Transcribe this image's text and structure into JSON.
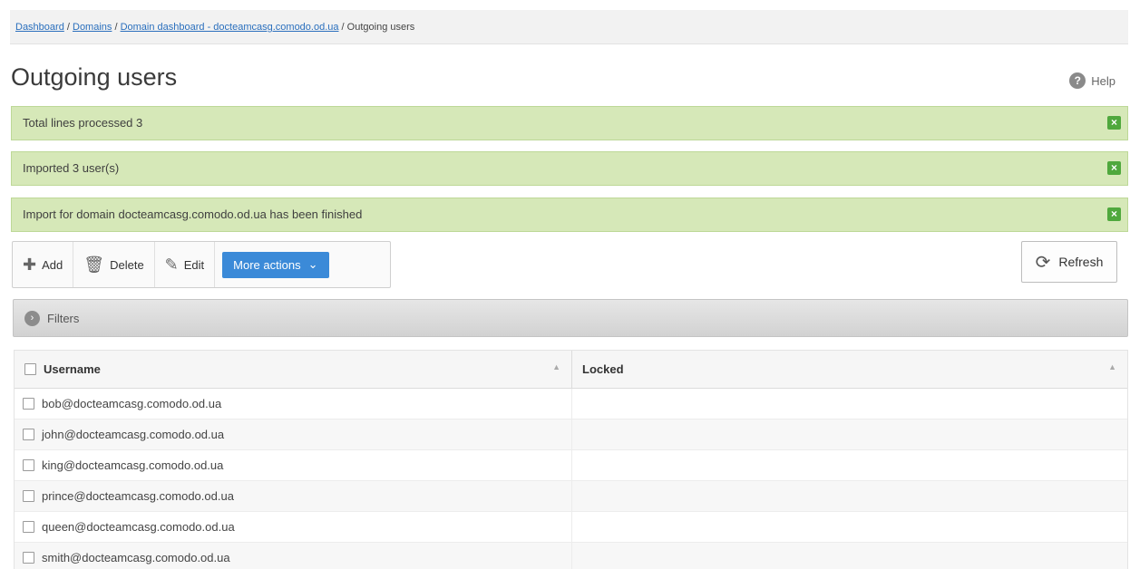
{
  "breadcrumb": {
    "items": [
      "Dashboard",
      "Domains",
      "Domain dashboard - docteamcasg.comodo.od.ua"
    ],
    "current": "Outgoing users",
    "sep": " / "
  },
  "page": {
    "title": "Outgoing users",
    "help": "Help"
  },
  "messages": [
    "Total lines processed 3",
    "Imported 3 user(s)",
    "Import for domain docteamcasg.comodo.od.ua has been finished"
  ],
  "toolbar": {
    "add": "Add",
    "delete": "Delete",
    "edit": "Edit",
    "more_actions": "More actions",
    "refresh": "Refresh"
  },
  "filters": {
    "label": "Filters"
  },
  "table": {
    "columns": [
      "Username",
      "Locked"
    ],
    "rows": [
      [
        "bob@docteamcasg.comodo.od.ua",
        ""
      ],
      [
        "john@docteamcasg.comodo.od.ua",
        ""
      ],
      [
        "king@docteamcasg.comodo.od.ua",
        ""
      ],
      [
        "prince@docteamcasg.comodo.od.ua",
        ""
      ],
      [
        "queen@docteamcasg.comodo.od.ua",
        ""
      ],
      [
        "smith@docteamcasg.comodo.od.ua",
        ""
      ]
    ]
  },
  "colors": {
    "accent": "#3b8ad8",
    "success_bg": "#d6e8b8",
    "close_icon": "#4fa83d"
  }
}
